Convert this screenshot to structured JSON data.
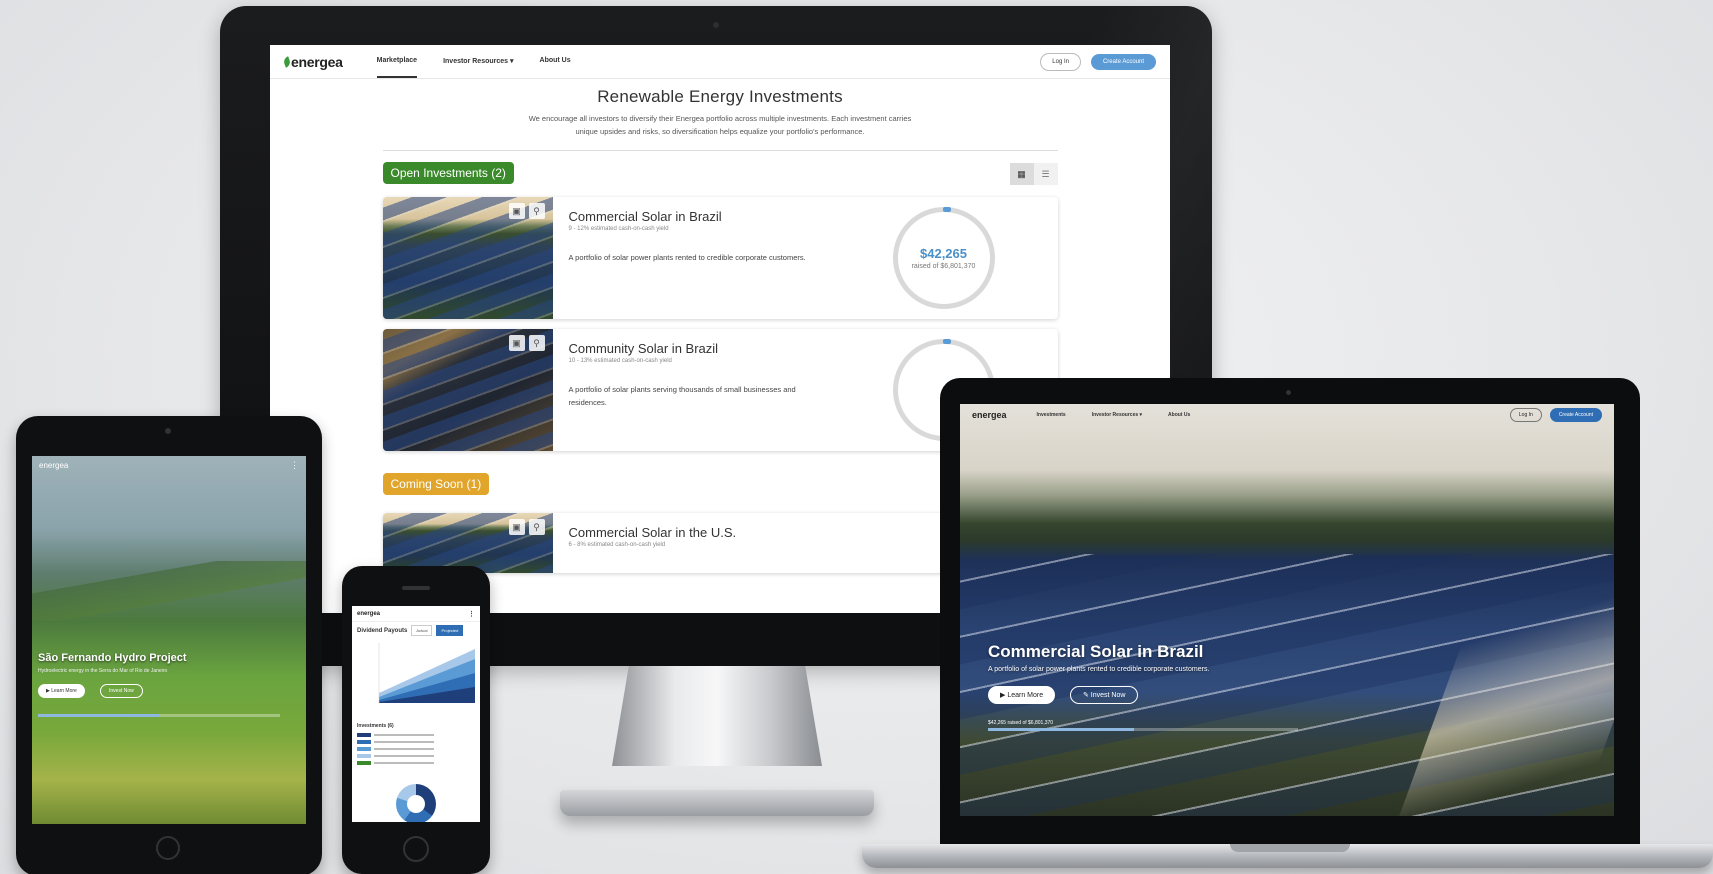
{
  "site": {
    "logo": "energea",
    "nav": [
      "Marketplace",
      "Investor Resources ▾",
      "About Us"
    ],
    "login": "Log In",
    "create_account": "Create Account"
  },
  "hero": {
    "title": "Renewable Energy Investments",
    "description": "We encourage all investors to diversify their Energea portfolio across multiple investments. Each investment carries unique upsides and risks, so diversification helps equalize your portfolio's performance."
  },
  "sections": {
    "open_label": "Open Investments (2)",
    "soon_label": "Coming Soon (1)"
  },
  "investments": [
    {
      "title": "Commercial Solar in Brazil",
      "yield": "9 - 12% estimated cash-on-cash yield",
      "description": "A portfolio of solar power plants rented to credible corporate customers.",
      "raised": "$42,265",
      "raised_of": "raised of $6,801,370"
    },
    {
      "title": "Community Solar in Brazil",
      "yield": "10 - 13% estimated cash-on-cash yield",
      "description": "A portfolio of solar plants serving thousands of small businesses and residences."
    },
    {
      "title": "Commercial Solar in the U.S.",
      "yield": "6 - 8% estimated cash-on-cash yield"
    }
  ],
  "tablet": {
    "logo": "energea",
    "title": "São Fernando Hydro Project",
    "subtitle": "Hydroelectric energy in the Serra do Mar of Rio de Janeiro",
    "learn_more": "▶ Learn More",
    "invest_now": "Invest Now",
    "progress": 0.5
  },
  "phone": {
    "logo": "energea",
    "chart_title": "Dividend Payouts",
    "tab_actual": "Actual",
    "tab_projected": "Projected",
    "investments_title": "Investments (6)"
  },
  "laptop": {
    "logo": "energea",
    "nav": [
      "Investments",
      "Investor Resources ▾",
      "About Us"
    ],
    "login": "Log In",
    "create_account": "Create Account",
    "title": "Commercial Solar in Brazil",
    "subtitle": "A portfolio of solar power plants rented to credible corporate customers.",
    "learn_more": "▶ Learn More",
    "invest_now": "✎ Invest Now",
    "raised_text": "$42,265 raised of $6,801,370",
    "progress": 0.47
  },
  "colors": {
    "open_green": "#3a8a2b",
    "soon_amber": "#e0a52a",
    "brand_blue": "#5b9bd5"
  }
}
